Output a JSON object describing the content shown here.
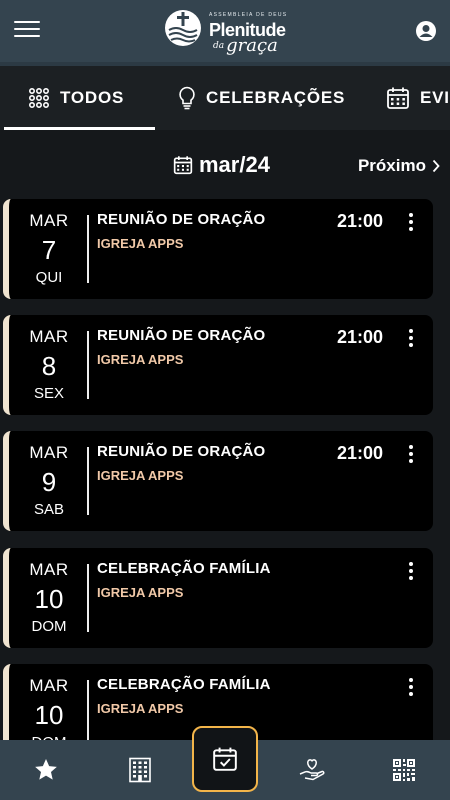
{
  "header": {
    "logo_small_text": "ASSEMBLEIA DE DEUS",
    "logo_main_text": "Plenitude",
    "logo_script_prefix": "da",
    "logo_script_text": "graça",
    "menu_icon": "hamburger-icon",
    "profile_icon": "account-circle-icon"
  },
  "tabs": [
    {
      "label": "TODOS",
      "icon": "grid-dots-icon",
      "active": true
    },
    {
      "label": "CELEBRAÇÕES",
      "icon": "lightbulb-icon",
      "active": false
    },
    {
      "label": "EVI",
      "icon": "calendar-icon",
      "active": false
    }
  ],
  "month_nav": {
    "current": "mar/24",
    "next_label": "Próximo"
  },
  "events": [
    {
      "month": "MAR",
      "day": "7",
      "weekday": "QUI",
      "title": "REUNIÃO DE ORAÇÃO",
      "org": "IGREJA APPS",
      "time": "21:00"
    },
    {
      "month": "MAR",
      "day": "8",
      "weekday": "SEX",
      "title": "REUNIÃO DE ORAÇÃO",
      "org": "IGREJA APPS",
      "time": "21:00"
    },
    {
      "month": "MAR",
      "day": "9",
      "weekday": "SAB",
      "title": "REUNIÃO DE ORAÇÃO",
      "org": "IGREJA APPS",
      "time": "21:00"
    },
    {
      "month": "MAR",
      "day": "10",
      "weekday": "DOM",
      "title": "CELEBRAÇÃO FAMÍLIA",
      "org": "IGREJA APPS",
      "time": ""
    },
    {
      "month": "MAR",
      "day": "10",
      "weekday": "DOM",
      "title": "CELEBRAÇÃO FAMÍLIA",
      "org": "IGREJA APPS",
      "time": ""
    }
  ],
  "bottom_nav": [
    {
      "icon": "star-icon",
      "active": false
    },
    {
      "icon": "building-icon",
      "active": false
    },
    {
      "icon": "calendar-check-icon",
      "active": true
    },
    {
      "icon": "donation-heart-hand-icon",
      "active": false
    },
    {
      "icon": "qr-code-icon",
      "active": false
    }
  ],
  "colors": {
    "header_bg": "#34444f",
    "page_bg": "#15181b",
    "card_bg": "#000000",
    "card_accent": "#f0e4d0",
    "org_text": "#f1c9a8",
    "active_nav_border": "#f3b54a"
  }
}
